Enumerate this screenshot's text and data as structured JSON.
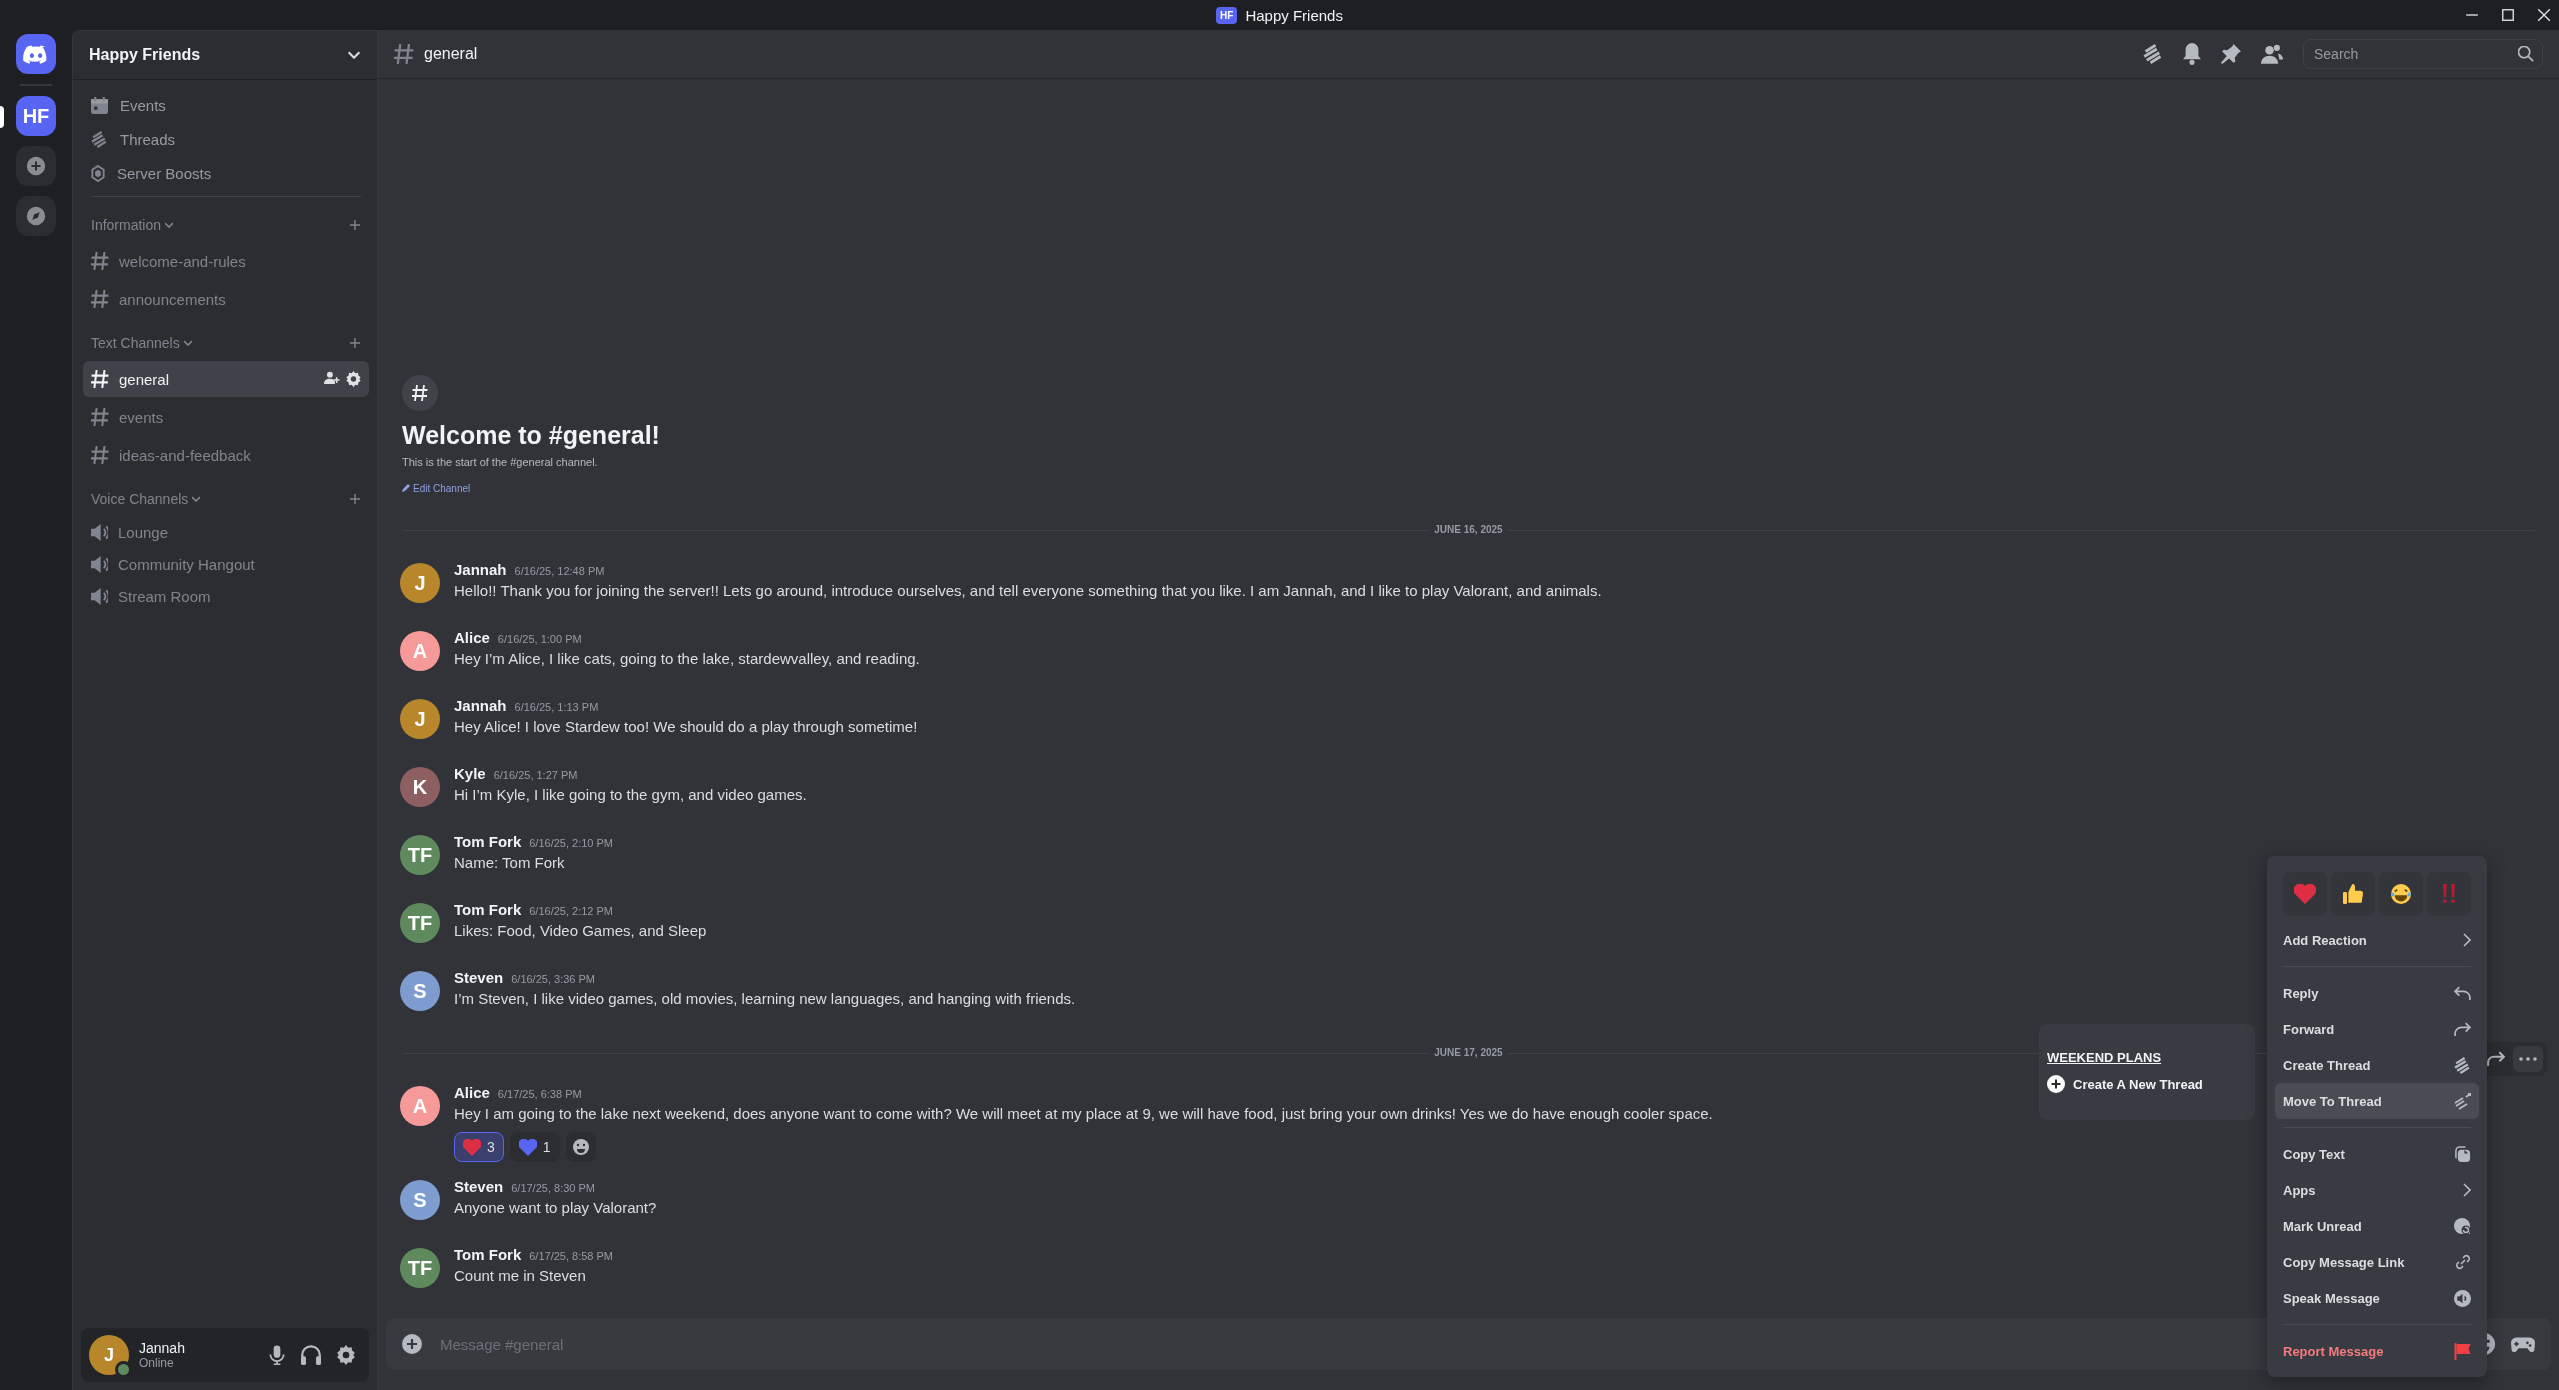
{
  "window": {
    "title": "Happy Friends",
    "badge": "HF"
  },
  "rail": [
    {
      "kind": "home",
      "selected": false
    },
    {
      "kind": "server",
      "label": "HF",
      "selected": true
    },
    {
      "kind": "add",
      "selected": false
    },
    {
      "kind": "explore",
      "selected": false
    }
  ],
  "sidebar": {
    "server_name": "Happy Friends",
    "shortcuts": [
      {
        "kind": "events",
        "label": "Events"
      },
      {
        "kind": "threads",
        "label": "Threads"
      },
      {
        "kind": "boosts",
        "label": "Server Boosts"
      }
    ],
    "categories": [
      {
        "name": "Information",
        "channels": [
          {
            "kind": "text",
            "name": "welcome-and-rules",
            "selected": false
          },
          {
            "kind": "text",
            "name": "announcements",
            "selected": false
          }
        ]
      },
      {
        "name": "Text Channels",
        "channels": [
          {
            "kind": "text",
            "name": "general",
            "selected": true
          },
          {
            "kind": "text",
            "name": "events",
            "selected": false
          },
          {
            "kind": "text",
            "name": "ideas-and-feedback",
            "selected": false
          }
        ]
      },
      {
        "name": "Voice Channels",
        "channels": [
          {
            "kind": "voice",
            "name": "Lounge",
            "selected": false
          },
          {
            "kind": "voice",
            "name": "Community Hangout",
            "selected": false
          },
          {
            "kind": "voice",
            "name": "Stream Room",
            "selected": false
          }
        ]
      }
    ]
  },
  "user_panel": {
    "initial": "J",
    "name": "Jannah",
    "status": "Online",
    "color": "#b8862b"
  },
  "header": {
    "channel": "general",
    "search_placeholder": "Search"
  },
  "welcome": {
    "title": "Welcome to #general!",
    "subtitle": "This is the start of the #general channel.",
    "edit_link": "Edit Channel"
  },
  "timeline": [
    {
      "kind": "divider",
      "label": "JUNE 16, 2025"
    },
    {
      "kind": "message",
      "initials": "J",
      "color": "#b8862b",
      "author": "Jannah",
      "time": "6/16/25, 12:48 PM",
      "text": "Hello!! Thank you for joining the server!! Lets go around, introduce ourselves, and tell everyone something that you like. I am Jannah, and I like to play Valorant, and animals."
    },
    {
      "kind": "message",
      "initials": "A",
      "color": "#f59a98",
      "author": "Alice",
      "time": "6/16/25, 1:00 PM",
      "text": "Hey I’m Alice, I like cats, going to the lake, stardewvalley, and reading."
    },
    {
      "kind": "message",
      "initials": "J",
      "color": "#b8862b",
      "author": "Jannah",
      "time": "6/16/25, 1:13 PM",
      "text": "Hey Alice! I love Stardew too! We should do a play through sometime!"
    },
    {
      "kind": "message",
      "initials": "K",
      "color": "#8e5f61",
      "author": "Kyle",
      "time": "6/16/25, 1:27 PM",
      "text": "Hi I’m Kyle, I like going to the gym, and video games."
    },
    {
      "kind": "message",
      "initials": "TF",
      "color": "#5f8a5e",
      "author": "Tom Fork",
      "time": "6/16/25, 2:10 PM",
      "text": "Name: Tom Fork"
    },
    {
      "kind": "message",
      "initials": "TF",
      "color": "#5f8a5e",
      "author": "Tom Fork",
      "time": "6/16/25, 2:12 PM",
      "text": "Likes: Food, Video Games, and Sleep"
    },
    {
      "kind": "message",
      "initials": "S",
      "color": "#7f9cd0",
      "author": "Steven",
      "time": "6/16/25, 3:36 PM",
      "text": "I’m Steven, I like video games, old movies, learning new languages, and hanging with friends."
    },
    {
      "kind": "divider",
      "label": "JUNE 17, 2025"
    },
    {
      "kind": "message",
      "initials": "A",
      "color": "#f59a98",
      "author": "Alice",
      "time": "6/17/25, 6:38 PM",
      "text": "Hey I am going to the lake next weekend, does anyone want to come with? We will meet at my place at 9, we will have food, just bring your own drinks! Yes we do have enough cooler space.",
      "reactions": [
        {
          "kind": "red-heart",
          "count": "3",
          "selected": true
        },
        {
          "kind": "blue-heart",
          "count": "1",
          "selected": false
        },
        {
          "kind": "add",
          "selected": false
        }
      ]
    },
    {
      "kind": "message",
      "initials": "S",
      "color": "#7f9cd0",
      "author": "Steven",
      "time": "6/17/25, 8:30 PM",
      "text": "Anyone want to play Valorant?"
    },
    {
      "kind": "message",
      "initials": "TF",
      "color": "#5f8a5e",
      "author": "Tom Fork",
      "time": "6/17/25, 8:58 PM",
      "text": "Count me in Steven"
    }
  ],
  "composer": {
    "placeholder": "Message #general"
  },
  "thread_popup": {
    "title": "WEEKEND PLANS",
    "action": "Create A New Thread"
  },
  "context_menu": {
    "quick_reactions": [
      {
        "kind": "heart"
      },
      {
        "kind": "thumbs-up"
      },
      {
        "kind": "laughing"
      },
      {
        "kind": "exclamation"
      }
    ],
    "groups": [
      {
        "items": [
          {
            "label": "Add Reaction",
            "kind": "submenu",
            "selected": false,
            "danger": false
          }
        ]
      },
      {
        "items": [
          {
            "label": "Reply",
            "kind": "reply",
            "selected": false,
            "danger": false
          },
          {
            "label": "Forward",
            "kind": "forward",
            "selected": false,
            "danger": false
          },
          {
            "label": "Create Thread",
            "kind": "thread",
            "selected": false,
            "danger": false
          },
          {
            "label": "Move To Thread",
            "kind": "thread-move",
            "selected": true,
            "danger": false
          }
        ]
      },
      {
        "items": [
          {
            "label": "Copy Text",
            "kind": "copy",
            "selected": false,
            "danger": false
          },
          {
            "label": "Apps",
            "kind": "submenu",
            "selected": false,
            "danger": false
          },
          {
            "label": "Mark Unread",
            "kind": "unread",
            "selected": false,
            "danger": false
          },
          {
            "label": "Copy Message Link",
            "kind": "link",
            "selected": false,
            "danger": false
          },
          {
            "label": "Speak Message",
            "kind": "speak",
            "selected": false,
            "danger": false
          }
        ]
      },
      {
        "items": [
          {
            "label": "Report Message",
            "kind": "flag",
            "selected": false,
            "danger": true
          }
        ]
      }
    ]
  }
}
